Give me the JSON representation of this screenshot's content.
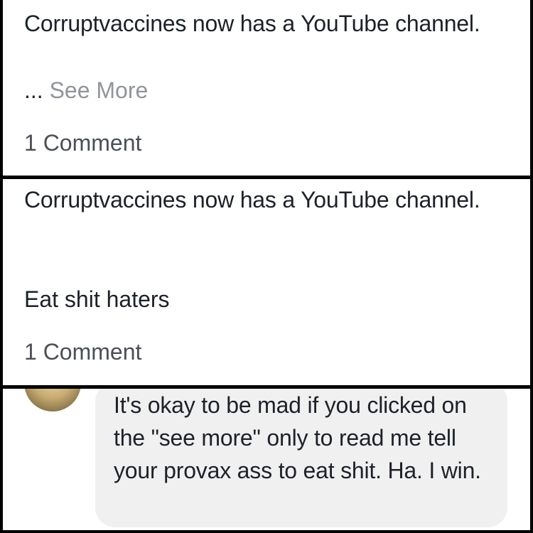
{
  "post1": {
    "text": "Corruptvaccines now has a YouTube channel.",
    "ellipsis": "...",
    "see_more": "See More",
    "comment_count": "1 Comment"
  },
  "post2": {
    "text": "Corruptvaccines now has a YouTube channel.",
    "extra_line": "Eat shit haters",
    "comment_count": "1 Comment"
  },
  "comment": {
    "text": "It's okay to be mad if you clicked on the \"see more\" only to read me tell your provax ass to eat shit. Ha. I win."
  },
  "colors": {
    "text": "#1d2129",
    "muted": "#90949c",
    "bubble": "#f1f0f0",
    "border": "#000000"
  }
}
